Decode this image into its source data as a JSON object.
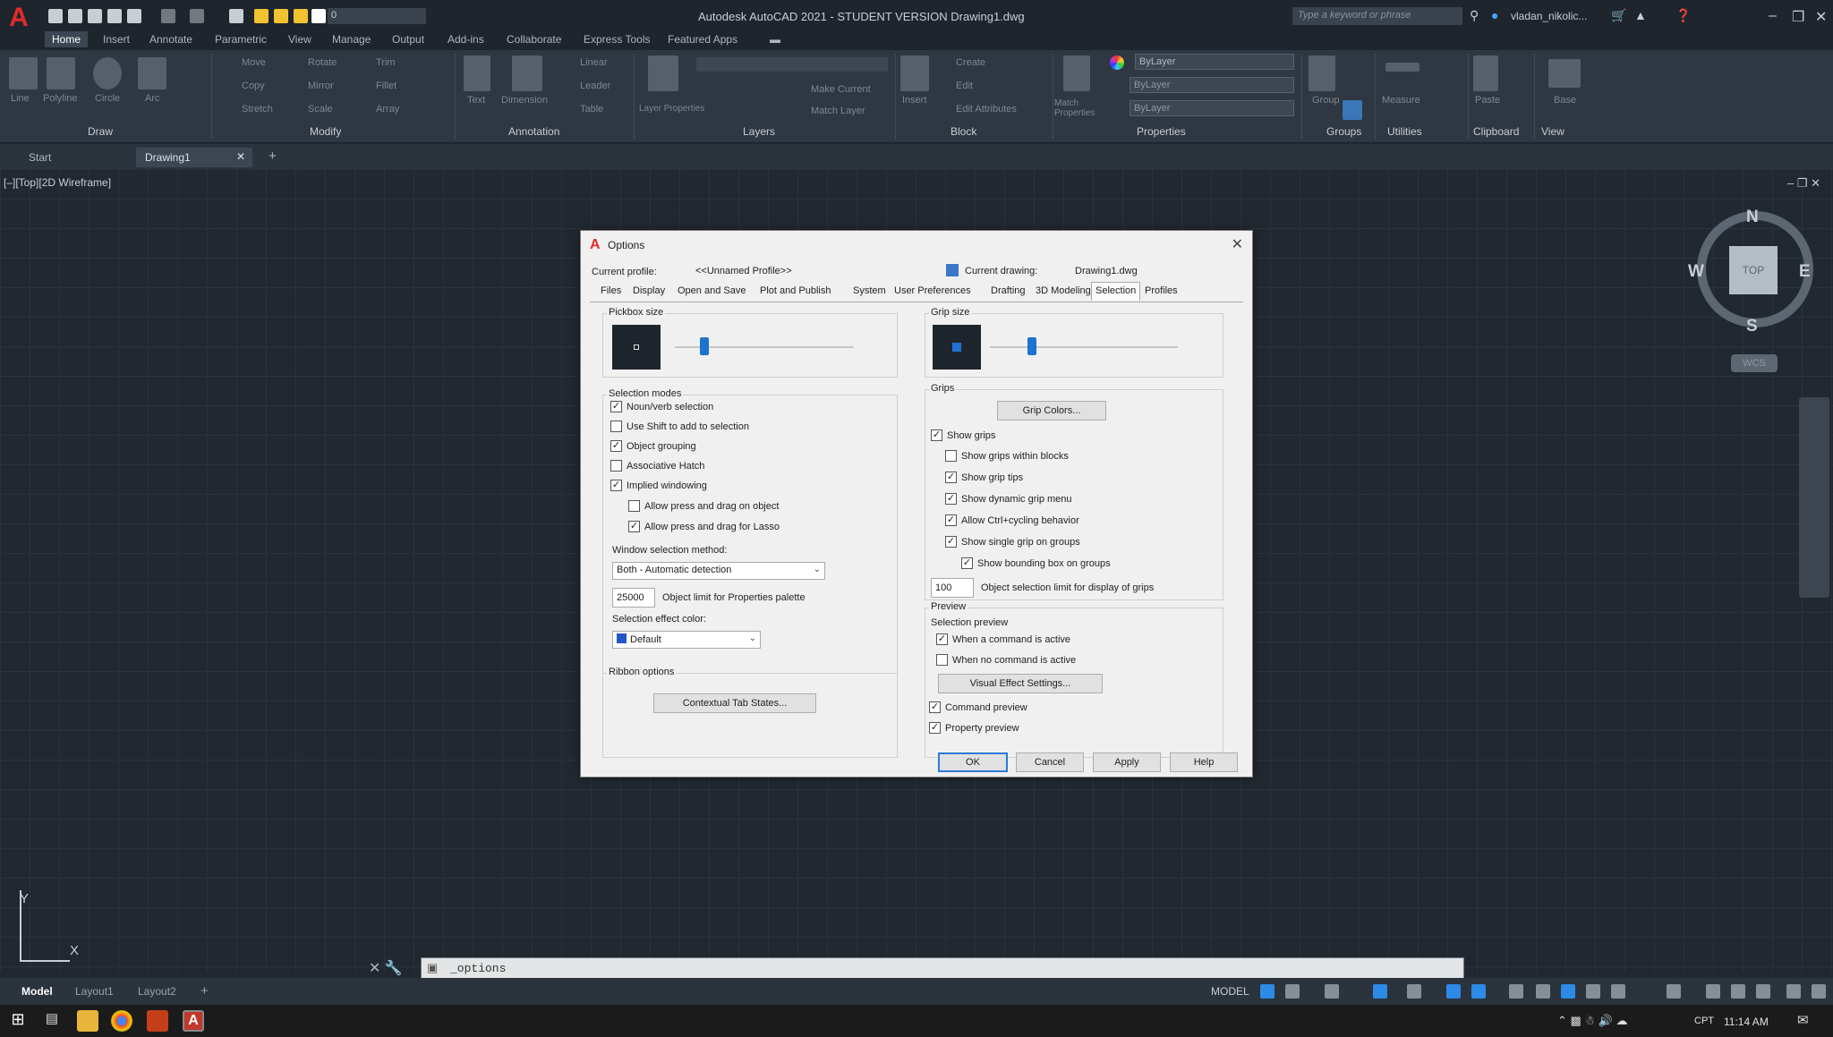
{
  "app": {
    "logo": "A",
    "window_title": "Autodesk AutoCAD 2021 - STUDENT VERSION    Drawing1.dwg",
    "search_placeholder": "Type a keyword or phrase",
    "user_name": "vladan_nikolic...",
    "layer_value": "0",
    "accent_color": "#2d8ae6"
  },
  "ribbon_tabs": [
    "Home",
    "Insert",
    "Annotate",
    "Parametric",
    "View",
    "Manage",
    "Output",
    "Add-ins",
    "Collaborate",
    "Express Tools",
    "Featured Apps"
  ],
  "ribbon_panels": [
    "Draw",
    "Modify",
    "Annotation",
    "Layers",
    "Block",
    "Properties",
    "Groups",
    "Utilities",
    "Clipboard",
    "View"
  ],
  "ribbon_items": {
    "line": "Line",
    "polyline": "Polyline",
    "circle": "Circle",
    "arc": "Arc",
    "move": "Move",
    "rotate": "Rotate",
    "trim": "Trim",
    "copy": "Copy",
    "mirror": "Mirror",
    "fillet": "Fillet",
    "stretch": "Stretch",
    "scale": "Scale",
    "array": "Array",
    "text": "Text",
    "dimension": "Dimension",
    "linear": "Linear",
    "leader": "Leader",
    "table": "Table",
    "layer_properties": "Layer Properties",
    "make_current": "Make Current",
    "match_layer": "Match Layer",
    "insert": "Insert",
    "create": "Create",
    "edit": "Edit",
    "edit_attributes": "Edit Attributes",
    "match_properties": "Match Properties",
    "bylayer": "ByLayer",
    "group": "Group",
    "measure": "Measure",
    "paste": "Paste",
    "base": "Base"
  },
  "file_tabs": [
    "Start",
    "Drawing1"
  ],
  "viewport_label": "[–][Top][2D Wireframe]",
  "viewcube": {
    "top": "TOP",
    "n": "N",
    "s": "S",
    "e": "E",
    "w": "W",
    "wcs": "WCS"
  },
  "ucs": {
    "x": "X",
    "y": "Y"
  },
  "command_line": {
    "text": "_options"
  },
  "layout_tabs": [
    "Model",
    "Layout1",
    "Layout2"
  ],
  "status_bar": {
    "model": "MODEL"
  },
  "taskbar": {
    "time": "11:14 AM",
    "lang": "CPT"
  },
  "dialog": {
    "title": "Options",
    "current_profile_label": "Current profile:",
    "current_profile_value": "<<Unnamed Profile>>",
    "current_drawing_label": "Current drawing:",
    "current_drawing_value": "Drawing1.dwg",
    "tabs": [
      "Files",
      "Display",
      "Open and Save",
      "Plot and Publish",
      "System",
      "User Preferences",
      "Drafting",
      "3D Modeling",
      "Selection",
      "Profiles"
    ],
    "active_tab": "Selection",
    "pickbox_size_label": "Pickbox size",
    "grip_size_label": "Grip size",
    "selection_modes_label": "Selection modes",
    "selection_modes": [
      {
        "label": "Noun/verb selection",
        "checked": true
      },
      {
        "label": "Use Shift to add to selection",
        "checked": false
      },
      {
        "label": "Object grouping",
        "checked": true
      },
      {
        "label": "Associative Hatch",
        "checked": false
      },
      {
        "label": "Implied windowing",
        "checked": true
      },
      {
        "label": "Allow press and drag on object",
        "checked": false
      },
      {
        "label": "Allow press and drag for Lasso",
        "checked": true
      }
    ],
    "window_selection_method_label": "Window selection method:",
    "window_selection_method_value": "Both - Automatic detection",
    "object_limit_value": "25000",
    "object_limit_label": "Object limit for Properties palette",
    "selection_effect_color_label": "Selection effect color:",
    "selection_effect_color_value": "Default",
    "ribbon_options_label": "Ribbon options",
    "contextual_tab_button": "Contextual Tab States...",
    "grips_label": "Grips",
    "grip_colors_button": "Grip Colors...",
    "grips": [
      {
        "label": "Show grips",
        "checked": true
      },
      {
        "label": "Show grips within blocks",
        "checked": false
      },
      {
        "label": "Show grip tips",
        "checked": true
      },
      {
        "label": "Show dynamic grip menu",
        "checked": true
      },
      {
        "label": "Allow Ctrl+cycling behavior",
        "checked": true
      },
      {
        "label": "Show single grip on groups",
        "checked": true
      },
      {
        "label": "Show bounding box on groups",
        "checked": true
      }
    ],
    "grip_limit_value": "100",
    "grip_limit_label": "Object selection limit for display of grips",
    "preview_label": "Preview",
    "selection_preview_label": "Selection preview",
    "preview_options": [
      {
        "label": "When a command is active",
        "checked": true
      },
      {
        "label": "When no command is active",
        "checked": false
      }
    ],
    "visual_effect_button": "Visual Effect Settings...",
    "command_preview": {
      "label": "Command preview",
      "checked": true
    },
    "property_preview": {
      "label": "Property preview",
      "checked": true
    },
    "buttons": {
      "ok": "OK",
      "cancel": "Cancel",
      "apply": "Apply",
      "help": "Help"
    }
  }
}
